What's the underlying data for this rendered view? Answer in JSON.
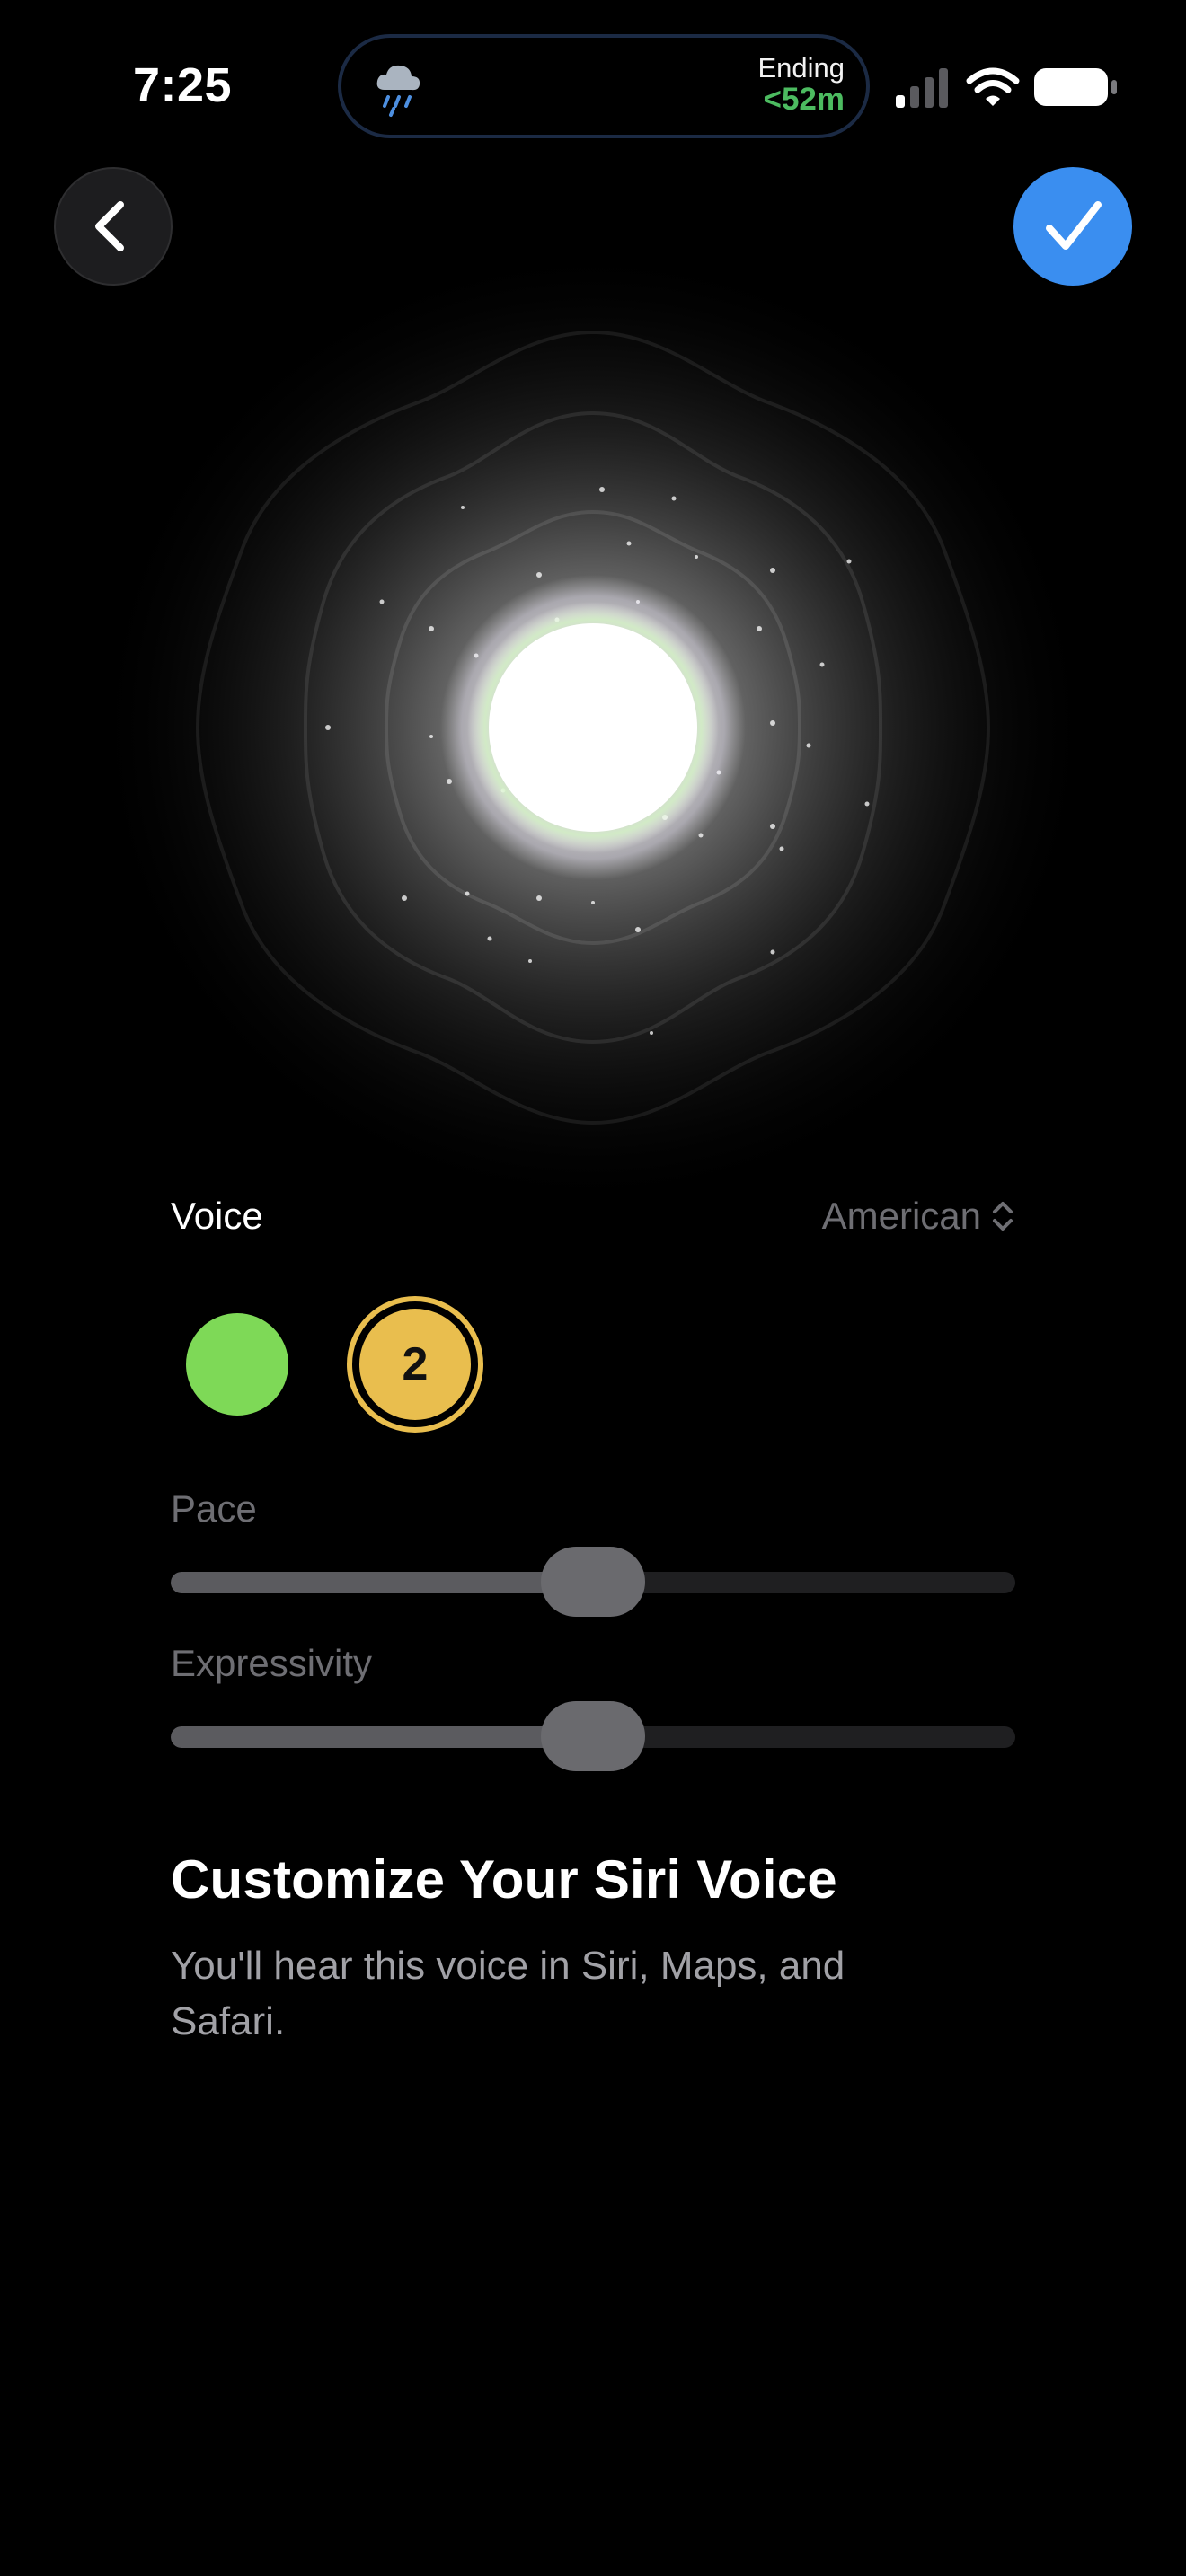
{
  "status_bar": {
    "time": "7:25",
    "live_activity": {
      "icon": "rain-cloud-icon",
      "label": "Ending",
      "value": "<52m",
      "value_color": "#4cbb60"
    },
    "signal_bars_active": 1,
    "signal_bars_total": 4,
    "battery_level": 0.95
  },
  "nav": {
    "back_icon": "chevron-left-icon",
    "done_icon": "checkmark-icon",
    "done_color": "#3a8ef0"
  },
  "voice": {
    "label": "Voice",
    "accent": "American",
    "accent_icon": "chevron-up-down-icon",
    "options": [
      {
        "id": "1",
        "label": "",
        "color": "#7ed957",
        "selected": false
      },
      {
        "id": "2",
        "label": "2",
        "color": "#e9be4e",
        "selected": true
      }
    ]
  },
  "sliders": {
    "pace": {
      "label": "Pace",
      "value": 0.5
    },
    "expressivity": {
      "label": "Expressivity",
      "value": 0.5
    }
  },
  "content": {
    "title": "Customize Your Siri Voice",
    "subtitle": "You'll hear this voice in Siri, Maps, and Safari."
  }
}
